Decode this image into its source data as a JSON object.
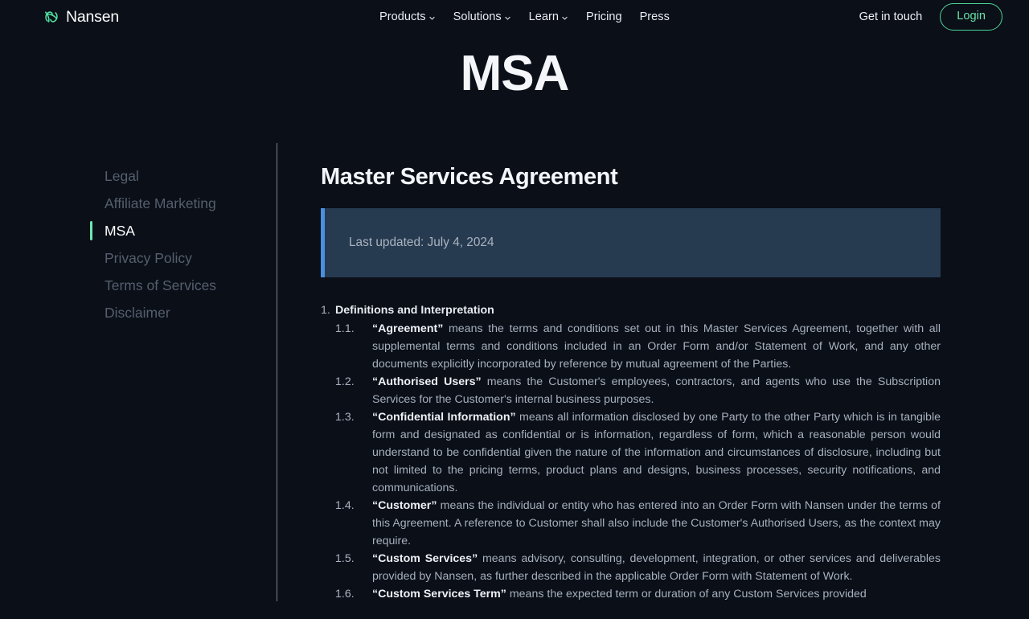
{
  "brand": {
    "name": "Nansen"
  },
  "nav": {
    "items": [
      {
        "label": "Products",
        "has_chevron": true
      },
      {
        "label": "Solutions",
        "has_chevron": true
      },
      {
        "label": "Learn",
        "has_chevron": true
      },
      {
        "label": "Pricing",
        "has_chevron": false
      },
      {
        "label": "Press",
        "has_chevron": false
      }
    ],
    "get_in_touch": "Get in touch",
    "login": "Login"
  },
  "hero": {
    "title": "MSA"
  },
  "sidebar": {
    "items": [
      {
        "label": "Legal",
        "active": false
      },
      {
        "label": "Affiliate Marketing",
        "active": false
      },
      {
        "label": "MSA",
        "active": true
      },
      {
        "label": "Privacy Policy",
        "active": false
      },
      {
        "label": "Terms of Services",
        "active": false
      },
      {
        "label": "Disclaimer",
        "active": false
      }
    ]
  },
  "document": {
    "title": "Master Services Agreement",
    "last_updated": "Last updated: July 4, 2024",
    "section_number": "1.",
    "section_title": "Definitions and Interpretation",
    "clauses": [
      {
        "number": "1.1.",
        "term": "“Agreement”",
        "text": " means the terms and conditions set out in this Master Services Agreement, together with all supplemental terms and conditions included in an Order Form and/or Statement of Work, and any other documents explicitly incorporated by reference by mutual agreement of the Parties."
      },
      {
        "number": "1.2.",
        "term": "“Authorised Users”",
        "text": " means the Customer's employees, contractors, and agents who use the Subscription Services for the Customer's internal business purposes."
      },
      {
        "number": "1.3.",
        "term": "“Confidential Information”",
        "text": " means all information disclosed by one Party to the other Party which is in tangible form and designated as confidential or is information, regardless of form, which a reasonable person would understand to be confidential given the nature of the information and circumstances of disclosure, including but not limited to the pricing terms, product plans and designs, business processes, security notifications, and communications."
      },
      {
        "number": "1.4.",
        "term": "“Customer”",
        "text": " means the individual or entity who has entered into an Order Form with Nansen under the terms of this Agreement. A reference to Customer shall also include the Customer's Authorised Users, as the context may require."
      },
      {
        "number": "1.5.",
        "term": "“Custom Services”",
        "text": " means advisory, consulting, development, integration, or other services and deliverables provided by Nansen, as further described in the applicable Order Form with Statement of Work."
      },
      {
        "number": "1.6.",
        "term": "“Custom Services Term”",
        "text": " means the expected term or duration of any Custom Services provided"
      }
    ]
  },
  "colors": {
    "background": "#0a0f18",
    "accent_green": "#6ee7b0",
    "notice_bar": "#4a8fe0",
    "notice_bg": "#263a50"
  }
}
